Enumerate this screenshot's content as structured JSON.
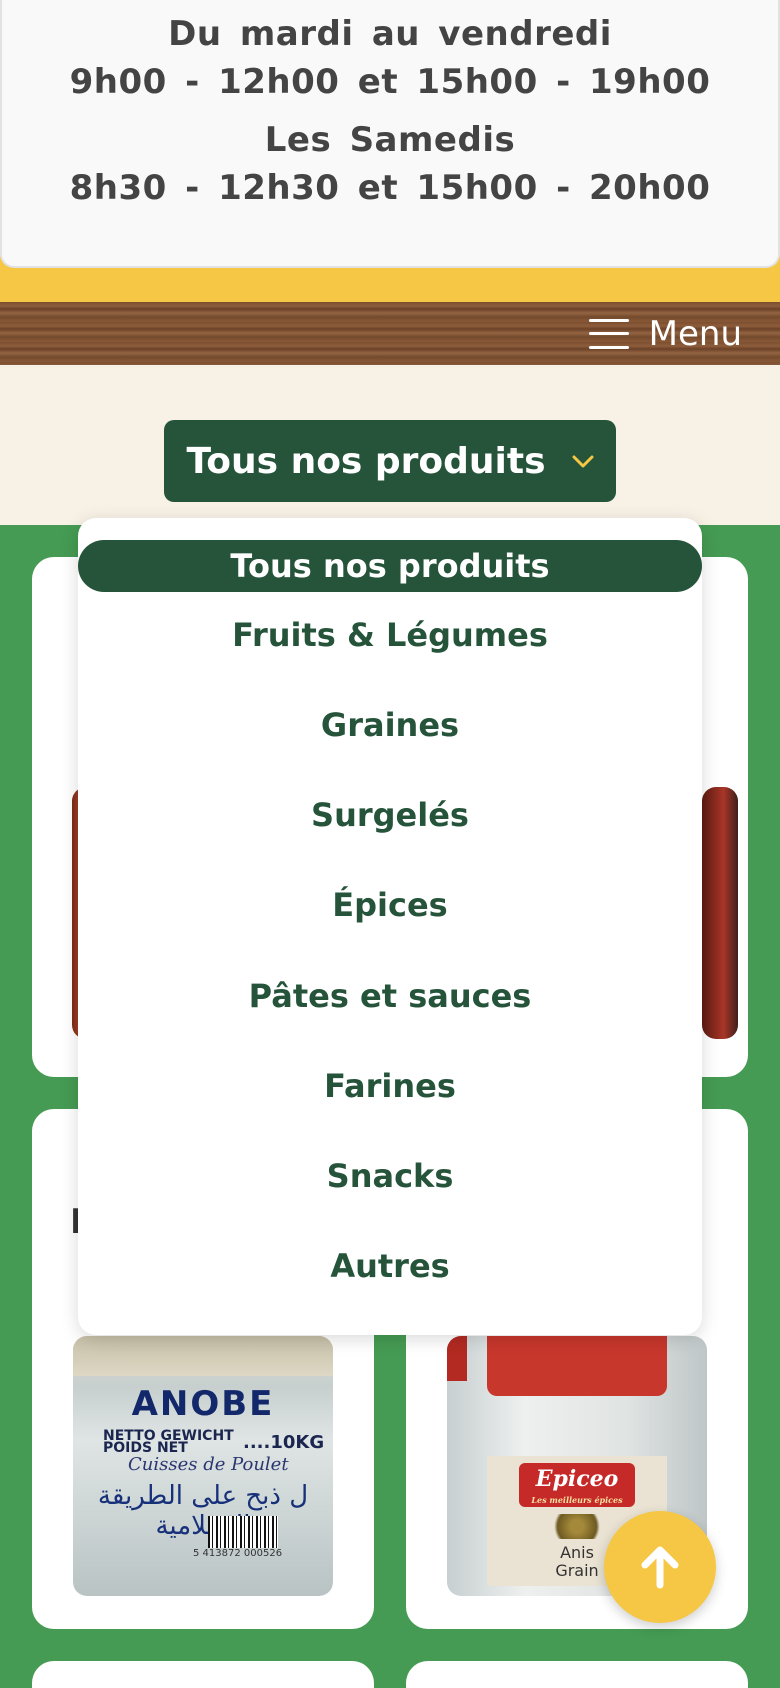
{
  "hours": {
    "weekday_label": "Du mardi au vendredi",
    "weekday_hours": "9h00 - 12h00 et 15h00 - 19h00",
    "saturday_label": "Les Samedis",
    "saturday_hours": "8h30 - 12h30 et 15h00 - 20h00"
  },
  "nav": {
    "menu_label": "Menu"
  },
  "category_dropdown": {
    "selected": "Tous nos produits",
    "options": [
      "Tous nos produits",
      "Fruits & Légumes",
      "Graines",
      "Surgelés",
      "Épices",
      "Pâtes et sauces",
      "Farines",
      "Snacks",
      "Autres"
    ]
  },
  "products": {
    "box": {
      "brand": "ANOBE",
      "weight_label_1": "NETTO GEWICHT",
      "weight_label_2": "POIDS NET",
      "weight": "....10KG",
      "handwritten": "Cuisses de Poulet",
      "arabic": "ل ذبح على الطريقة الإسلامية",
      "barcode": "5 413872 000526"
    },
    "jar": {
      "brand": "Epiceo",
      "tagline": "Les meilleurs épices",
      "name_1": "Anis",
      "name_2": "Grain"
    }
  },
  "colors": {
    "green_dark": "#25543a",
    "green_bg": "#459b53",
    "yellow": "#f6c744",
    "cream": "#f7f1e6"
  },
  "icons": {
    "menu": "hamburger-icon",
    "dropdown": "chevron-down-icon",
    "scroll": "arrow-up-icon"
  }
}
